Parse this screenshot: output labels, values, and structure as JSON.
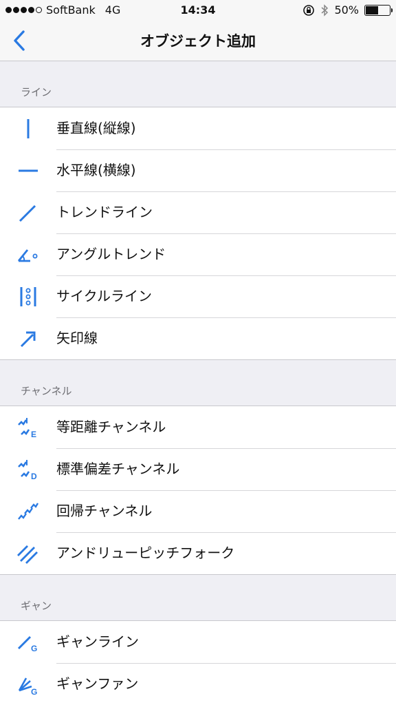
{
  "status_bar": {
    "carrier": "SoftBank",
    "network": "4G",
    "time": "14:34",
    "battery_percent": "50%",
    "battery_level": 0.5
  },
  "nav": {
    "title": "オブジェクト追加",
    "back_icon": "chevron-left-icon"
  },
  "accent_color": "#2a7ae2",
  "sections": [
    {
      "header": "ライン",
      "items": [
        {
          "label": "垂直線(縦線)",
          "icon": "vertical-line-icon"
        },
        {
          "label": "水平線(横線)",
          "icon": "horizontal-line-icon"
        },
        {
          "label": "トレンドライン",
          "icon": "trendline-icon"
        },
        {
          "label": "アングルトレンド",
          "icon": "angle-trend-icon"
        },
        {
          "label": "サイクルライン",
          "icon": "cycle-line-icon"
        },
        {
          "label": "矢印線",
          "icon": "arrow-line-icon"
        }
      ]
    },
    {
      "header": "チャンネル",
      "items": [
        {
          "label": "等距離チャンネル",
          "icon": "equidistant-channel-icon"
        },
        {
          "label": "標準偏差チャンネル",
          "icon": "std-dev-channel-icon"
        },
        {
          "label": "回帰チャンネル",
          "icon": "regression-channel-icon"
        },
        {
          "label": "アンドリューピッチフォーク",
          "icon": "andrews-pitchfork-icon"
        }
      ]
    },
    {
      "header": "ギャン",
      "items": [
        {
          "label": "ギャンライン",
          "icon": "gann-line-icon"
        },
        {
          "label": "ギャンファン",
          "icon": "gann-fan-icon"
        }
      ]
    }
  ]
}
